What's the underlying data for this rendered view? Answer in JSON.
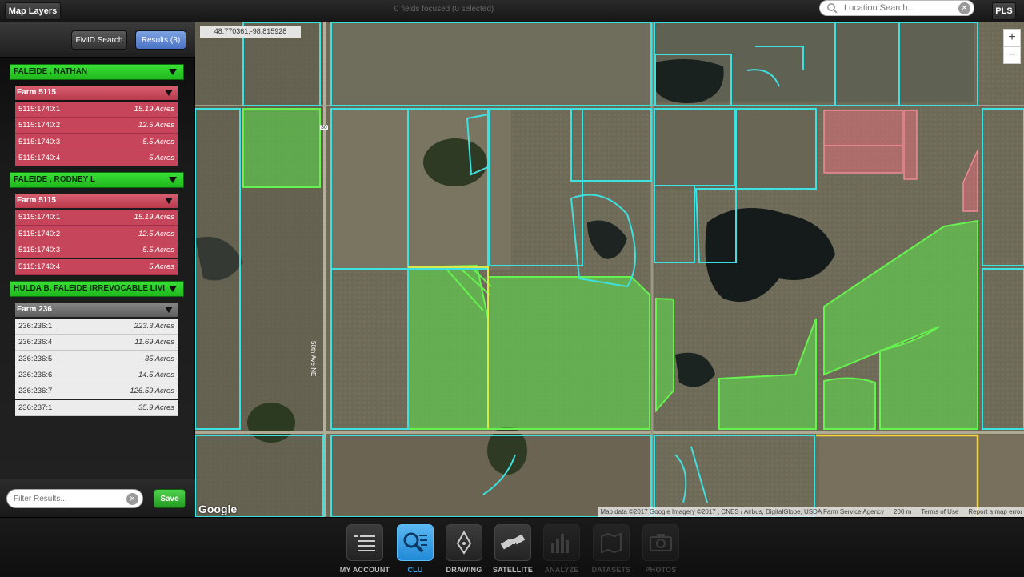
{
  "topbar": {
    "map_layers_label": "Map Layers",
    "focus_status": "0 fields focused (0 selected)",
    "location_search_placeholder": "Location Search...",
    "pls_label": "PLS"
  },
  "sidebar": {
    "fmid_search_label": "FMID Search",
    "results_label": "Results (3)",
    "groups": [
      {
        "owner": "FALEIDE , NATHAN",
        "farm": "Farm 5115",
        "fields": [
          {
            "id": "5115:1740:1",
            "acres": "15.19 Acres"
          },
          {
            "id": "5115:1740:2",
            "acres": "12.5 Acres"
          },
          {
            "id": "5115:1740:3",
            "acres": "5.5 Acres"
          },
          {
            "id": "5115:1740:4",
            "acres": "5 Acres"
          }
        ]
      },
      {
        "owner": "FALEIDE , RODNEY L",
        "farm": "Farm 5115",
        "fields": [
          {
            "id": "5115:1740:1",
            "acres": "15.19 Acres"
          },
          {
            "id": "5115:1740:2",
            "acres": "12.5 Acres"
          },
          {
            "id": "5115:1740:3",
            "acres": "5.5 Acres"
          },
          {
            "id": "5115:1740:4",
            "acres": "5 Acres"
          }
        ]
      },
      {
        "owner": "HULDA B. FALEIDE IRREVOCABLE LIVI",
        "farm": "Farm 236",
        "fields": [
          {
            "id": "236:236:1",
            "acres": "223.3 Acres"
          },
          {
            "id": "236:236:4",
            "acres": "11.69 Acres"
          },
          {
            "id": "236:236:5",
            "acres": "35 Acres"
          },
          {
            "id": "236:236:6",
            "acres": "14.5 Acres"
          },
          {
            "id": "236:236:7",
            "acres": "126.59 Acres"
          },
          {
            "id": "236:237:1",
            "acres": "35.9 Acres"
          }
        ]
      }
    ],
    "filter_placeholder": "Filter Results...",
    "save_label": "Save"
  },
  "map": {
    "coordinates": "48.770361,-98.815928",
    "zoom_in": "+",
    "zoom_out": "−",
    "google_logo": "Google",
    "road_label": "50th Ave NE",
    "highway_label": "30",
    "attribution": "Map data ©2017 Google Imagery ©2017 , CNES / Airbus, DigitalGlobe, USDA Farm Service Agency",
    "scale": "200 m",
    "terms": "Terms of Use",
    "report": "Report a map error"
  },
  "bottom_nav": [
    {
      "label": "MY ACCOUNT",
      "icon": "list-icon",
      "state": "normal"
    },
    {
      "label": "CLU",
      "icon": "search-list-icon",
      "state": "active"
    },
    {
      "label": "DRAWING",
      "icon": "pen-nib-icon",
      "state": "normal"
    },
    {
      "label": "SATELLITE",
      "icon": "satellite-icon",
      "state": "normal"
    },
    {
      "label": "ANALYZE",
      "icon": "bar-chart-icon",
      "state": "disabled"
    },
    {
      "label": "DATASETS",
      "icon": "datasets-map-icon",
      "state": "disabled"
    },
    {
      "label": "PHOTOS",
      "icon": "camera-icon",
      "state": "disabled"
    }
  ],
  "colors": {
    "boundary": "#3fe0e0",
    "selected_green": "#5ce34a",
    "selected_red": "#e0707a",
    "active_nav": "#2f9fe8"
  }
}
